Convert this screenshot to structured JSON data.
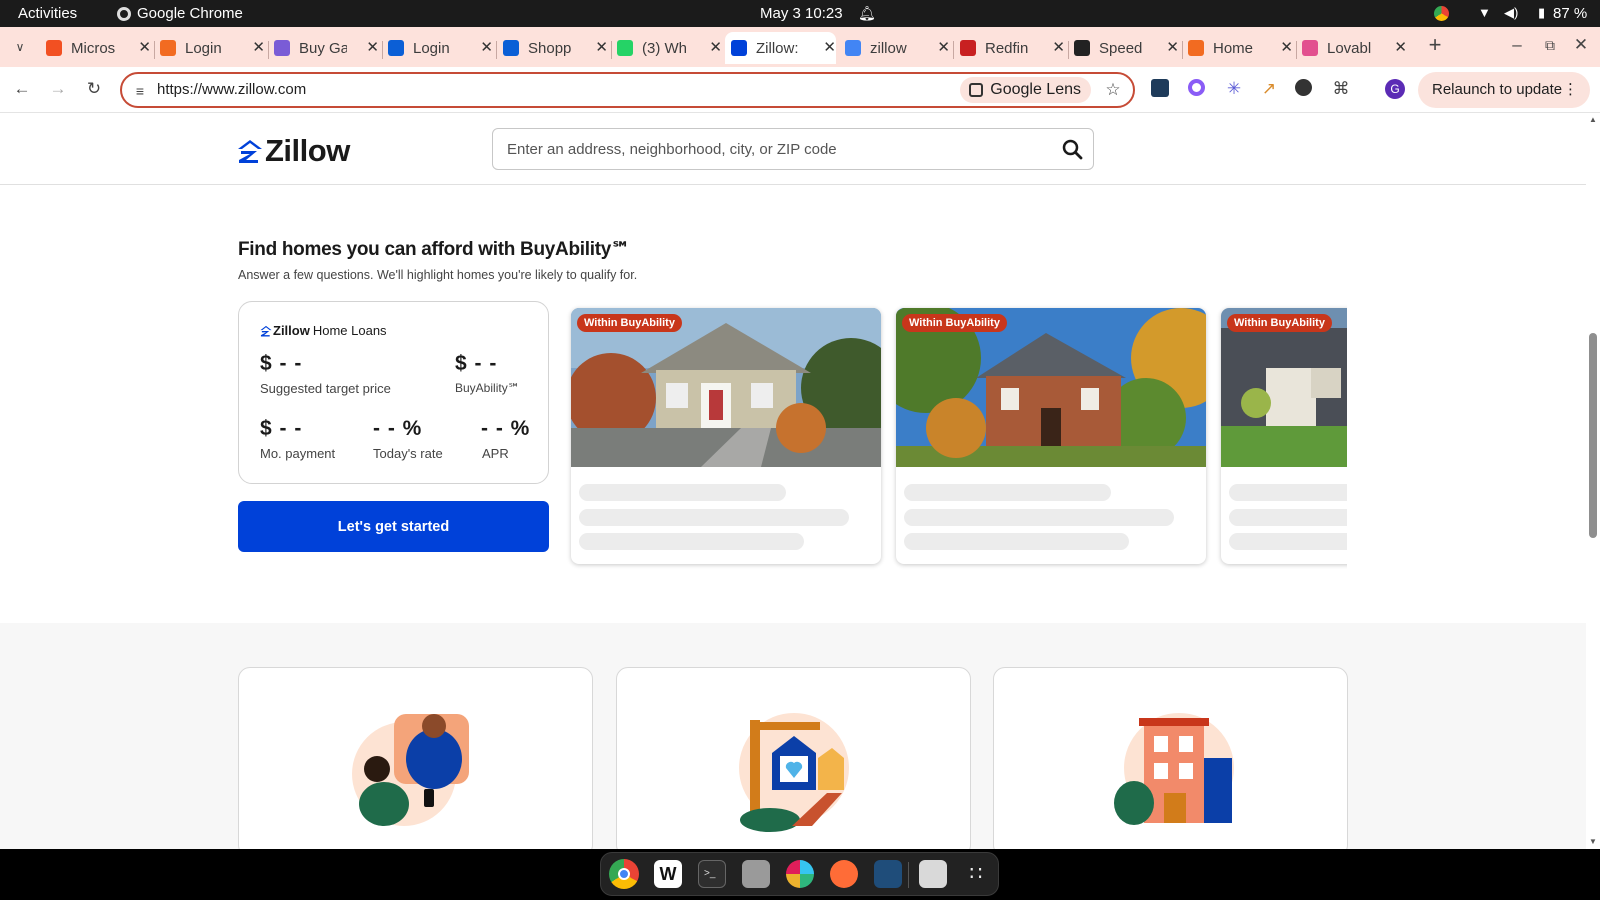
{
  "system_bar": {
    "activities": "Activities",
    "app_name": "Google Chrome",
    "datetime": "May 3  10:23",
    "battery": "87 %"
  },
  "tabs": [
    {
      "title": "Micros",
      "color": "#f25022"
    },
    {
      "title": "Login",
      "color": "#f26b21"
    },
    {
      "title": "Buy Ga",
      "color": "#7a5cd6"
    },
    {
      "title": "Login",
      "color": "#0b5fd6"
    },
    {
      "title": "Shopp",
      "color": "#0b5fd6"
    },
    {
      "title": "(3) Wh",
      "color": "#25d366"
    },
    {
      "title": "Zillow:",
      "color": "#0041d9"
    },
    {
      "title": "zillow",
      "color": "#4285f4"
    },
    {
      "title": "Redfin",
      "color": "#c82021"
    },
    {
      "title": "Speed",
      "color": "#222222"
    },
    {
      "title": "Home",
      "color": "#f26b21"
    },
    {
      "title": "Lovabl",
      "color": "#e2508f"
    }
  ],
  "toolbar": {
    "url": "https://www.zillow.com",
    "lens_label": "Google Lens",
    "relaunch_label": "Relaunch to update",
    "profile_initial": "G"
  },
  "zillow": {
    "logo_text": "Zillow",
    "search_placeholder": "Enter an address, neighborhood, city, or ZIP code",
    "heading": "Find homes you can afford with BuyAbility℠",
    "subheading": "Answer a few questions. We'll highlight homes you're likely to qualify for.",
    "loan_card": {
      "brand_bold": "Zillow",
      "brand_light": "Home Loans",
      "target_price_value": "$ - -",
      "target_price_label": "Suggested target price",
      "buyability_value": "$ - -",
      "buyability_label": "BuyAbility℠",
      "payment_value": "$ - -",
      "payment_label": "Mo. payment",
      "rate_value": "- - %",
      "rate_label": "Today's rate",
      "apr_value": "- - %",
      "apr_label": "APR"
    },
    "cta_label": "Let's get started",
    "listings": [
      {
        "badge": "Within BuyAbility"
      },
      {
        "badge": "Within BuyAbility"
      },
      {
        "badge": "Within BuyAbility"
      }
    ]
  },
  "icons": [
    "chrome-icon",
    "notes-icon",
    "terminal-icon",
    "files-icon",
    "slack-icon",
    "postman-icon",
    "vscode-icon",
    "trash-icon",
    "app-grid-icon"
  ]
}
